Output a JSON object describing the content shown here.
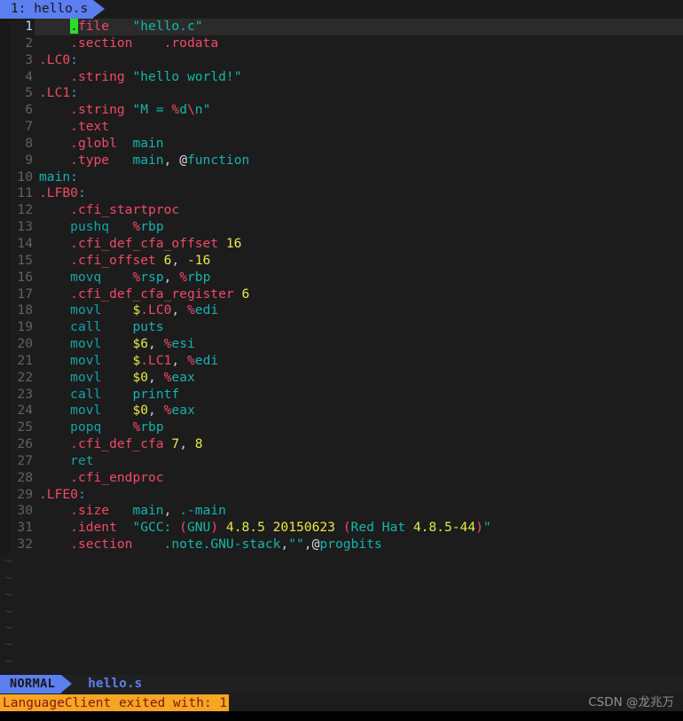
{
  "tabline": {
    "active_tab": "1: hello.s"
  },
  "editor": {
    "filetype": "asm",
    "cursor_char": ".",
    "lines": [
      {
        "n": "1",
        "current": true,
        "tokens": [
          {
            "t": "    ",
            "c": "punct"
          },
          {
            "t": ".",
            "c": "cursor"
          },
          {
            "t": "file",
            "c": "dir"
          },
          {
            "t": "   ",
            "c": "punct"
          },
          {
            "t": "\"hello.c\"",
            "c": "str"
          }
        ]
      },
      {
        "n": "2",
        "current": false,
        "tokens": [
          {
            "t": "    ",
            "c": "punct"
          },
          {
            "t": ".section",
            "c": "dir"
          },
          {
            "t": "    ",
            "c": "punct"
          },
          {
            "t": ".rodata",
            "c": "dir"
          }
        ]
      },
      {
        "n": "3",
        "current": false,
        "tokens": [
          {
            "t": ".LC0",
            "c": "lbl"
          },
          {
            "t": ":",
            "c": "colon"
          }
        ]
      },
      {
        "n": "4",
        "current": false,
        "tokens": [
          {
            "t": "    ",
            "c": "punct"
          },
          {
            "t": ".string",
            "c": "dir"
          },
          {
            "t": " ",
            "c": "punct"
          },
          {
            "t": "\"hello world!\"",
            "c": "str"
          }
        ]
      },
      {
        "n": "5",
        "current": false,
        "tokens": [
          {
            "t": ".LC1",
            "c": "lbl"
          },
          {
            "t": ":",
            "c": "colon"
          }
        ]
      },
      {
        "n": "6",
        "current": false,
        "tokens": [
          {
            "t": "    ",
            "c": "punct"
          },
          {
            "t": ".string",
            "c": "dir"
          },
          {
            "t": " ",
            "c": "punct"
          },
          {
            "t": "\"M = ",
            "c": "str"
          },
          {
            "t": "%",
            "c": "pct"
          },
          {
            "t": "d",
            "c": "str"
          },
          {
            "t": "\\",
            "c": "pct"
          },
          {
            "t": "n\"",
            "c": "str"
          }
        ]
      },
      {
        "n": "7",
        "current": false,
        "tokens": [
          {
            "t": "    ",
            "c": "punct"
          },
          {
            "t": ".text",
            "c": "dir"
          }
        ]
      },
      {
        "n": "8",
        "current": false,
        "tokens": [
          {
            "t": "    ",
            "c": "punct"
          },
          {
            "t": ".globl",
            "c": "dir"
          },
          {
            "t": "  ",
            "c": "punct"
          },
          {
            "t": "main",
            "c": "id"
          }
        ]
      },
      {
        "n": "9",
        "current": false,
        "tokens": [
          {
            "t": "    ",
            "c": "punct"
          },
          {
            "t": ".type",
            "c": "dir"
          },
          {
            "t": "   ",
            "c": "punct"
          },
          {
            "t": "main",
            "c": "id"
          },
          {
            "t": ", ",
            "c": "punct"
          },
          {
            "t": "@",
            "c": "at"
          },
          {
            "t": "function",
            "c": "id"
          }
        ]
      },
      {
        "n": "10",
        "current": false,
        "tokens": [
          {
            "t": "main",
            "c": "id"
          },
          {
            "t": ":",
            "c": "colon"
          }
        ]
      },
      {
        "n": "11",
        "current": false,
        "tokens": [
          {
            "t": ".LFB0",
            "c": "lbl"
          },
          {
            "t": ":",
            "c": "colon"
          }
        ]
      },
      {
        "n": "12",
        "current": false,
        "tokens": [
          {
            "t": "    ",
            "c": "punct"
          },
          {
            "t": ".cfi_startproc",
            "c": "dir"
          }
        ]
      },
      {
        "n": "13",
        "current": false,
        "tokens": [
          {
            "t": "    ",
            "c": "punct"
          },
          {
            "t": "pushq",
            "c": "kw"
          },
          {
            "t": "   ",
            "c": "punct"
          },
          {
            "t": "%",
            "c": "pct"
          },
          {
            "t": "rbp",
            "c": "id"
          }
        ]
      },
      {
        "n": "14",
        "current": false,
        "tokens": [
          {
            "t": "    ",
            "c": "punct"
          },
          {
            "t": ".cfi_def_cfa_offset",
            "c": "dir"
          },
          {
            "t": " ",
            "c": "punct"
          },
          {
            "t": "16",
            "c": "num"
          }
        ]
      },
      {
        "n": "15",
        "current": false,
        "tokens": [
          {
            "t": "    ",
            "c": "punct"
          },
          {
            "t": ".cfi_offset",
            "c": "dir"
          },
          {
            "t": " ",
            "c": "punct"
          },
          {
            "t": "6",
            "c": "num"
          },
          {
            "t": ", ",
            "c": "punct"
          },
          {
            "t": "-16",
            "c": "num"
          }
        ]
      },
      {
        "n": "16",
        "current": false,
        "tokens": [
          {
            "t": "    ",
            "c": "punct"
          },
          {
            "t": "movq",
            "c": "kw"
          },
          {
            "t": "    ",
            "c": "punct"
          },
          {
            "t": "%",
            "c": "pct"
          },
          {
            "t": "rsp",
            "c": "id"
          },
          {
            "t": ", ",
            "c": "punct"
          },
          {
            "t": "%",
            "c": "pct"
          },
          {
            "t": "rbp",
            "c": "id"
          }
        ]
      },
      {
        "n": "17",
        "current": false,
        "tokens": [
          {
            "t": "    ",
            "c": "punct"
          },
          {
            "t": ".cfi_def_cfa_register",
            "c": "dir"
          },
          {
            "t": " ",
            "c": "punct"
          },
          {
            "t": "6",
            "c": "num"
          }
        ]
      },
      {
        "n": "18",
        "current": false,
        "tokens": [
          {
            "t": "    ",
            "c": "punct"
          },
          {
            "t": "movl",
            "c": "kw"
          },
          {
            "t": "    ",
            "c": "punct"
          },
          {
            "t": "$",
            "c": "num"
          },
          {
            "t": ".LC0",
            "c": "lbl"
          },
          {
            "t": ", ",
            "c": "punct"
          },
          {
            "t": "%",
            "c": "pct"
          },
          {
            "t": "edi",
            "c": "id"
          }
        ]
      },
      {
        "n": "19",
        "current": false,
        "tokens": [
          {
            "t": "    ",
            "c": "punct"
          },
          {
            "t": "call",
            "c": "kw"
          },
          {
            "t": "    ",
            "c": "punct"
          },
          {
            "t": "puts",
            "c": "id"
          }
        ]
      },
      {
        "n": "20",
        "current": false,
        "tokens": [
          {
            "t": "    ",
            "c": "punct"
          },
          {
            "t": "movl",
            "c": "kw"
          },
          {
            "t": "    ",
            "c": "punct"
          },
          {
            "t": "$6",
            "c": "num"
          },
          {
            "t": ", ",
            "c": "punct"
          },
          {
            "t": "%",
            "c": "pct"
          },
          {
            "t": "esi",
            "c": "id"
          }
        ]
      },
      {
        "n": "21",
        "current": false,
        "tokens": [
          {
            "t": "    ",
            "c": "punct"
          },
          {
            "t": "movl",
            "c": "kw"
          },
          {
            "t": "    ",
            "c": "punct"
          },
          {
            "t": "$",
            "c": "num"
          },
          {
            "t": ".LC1",
            "c": "lbl"
          },
          {
            "t": ", ",
            "c": "punct"
          },
          {
            "t": "%",
            "c": "pct"
          },
          {
            "t": "edi",
            "c": "id"
          }
        ]
      },
      {
        "n": "22",
        "current": false,
        "tokens": [
          {
            "t": "    ",
            "c": "punct"
          },
          {
            "t": "movl",
            "c": "kw"
          },
          {
            "t": "    ",
            "c": "punct"
          },
          {
            "t": "$0",
            "c": "num"
          },
          {
            "t": ", ",
            "c": "punct"
          },
          {
            "t": "%",
            "c": "pct"
          },
          {
            "t": "eax",
            "c": "id"
          }
        ]
      },
      {
        "n": "23",
        "current": false,
        "tokens": [
          {
            "t": "    ",
            "c": "punct"
          },
          {
            "t": "call",
            "c": "kw"
          },
          {
            "t": "    ",
            "c": "punct"
          },
          {
            "t": "printf",
            "c": "id"
          }
        ]
      },
      {
        "n": "24",
        "current": false,
        "tokens": [
          {
            "t": "    ",
            "c": "punct"
          },
          {
            "t": "movl",
            "c": "kw"
          },
          {
            "t": "    ",
            "c": "punct"
          },
          {
            "t": "$0",
            "c": "num"
          },
          {
            "t": ", ",
            "c": "punct"
          },
          {
            "t": "%",
            "c": "pct"
          },
          {
            "t": "eax",
            "c": "id"
          }
        ]
      },
      {
        "n": "25",
        "current": false,
        "tokens": [
          {
            "t": "    ",
            "c": "punct"
          },
          {
            "t": "popq",
            "c": "kw"
          },
          {
            "t": "    ",
            "c": "punct"
          },
          {
            "t": "%",
            "c": "pct"
          },
          {
            "t": "rbp",
            "c": "id"
          }
        ]
      },
      {
        "n": "26",
        "current": false,
        "tokens": [
          {
            "t": "    ",
            "c": "punct"
          },
          {
            "t": ".cfi_def_cfa",
            "c": "dir"
          },
          {
            "t": " ",
            "c": "punct"
          },
          {
            "t": "7",
            "c": "num"
          },
          {
            "t": ", ",
            "c": "punct"
          },
          {
            "t": "8",
            "c": "num"
          }
        ]
      },
      {
        "n": "27",
        "current": false,
        "tokens": [
          {
            "t": "    ",
            "c": "punct"
          },
          {
            "t": "ret",
            "c": "kw"
          }
        ]
      },
      {
        "n": "28",
        "current": false,
        "tokens": [
          {
            "t": "    ",
            "c": "punct"
          },
          {
            "t": ".cfi_endproc",
            "c": "dir"
          }
        ]
      },
      {
        "n": "29",
        "current": false,
        "tokens": [
          {
            "t": ".LFE0",
            "c": "lbl"
          },
          {
            "t": ":",
            "c": "colon"
          }
        ]
      },
      {
        "n": "30",
        "current": false,
        "tokens": [
          {
            "t": "    ",
            "c": "punct"
          },
          {
            "t": ".size",
            "c": "dir"
          },
          {
            "t": "   ",
            "c": "punct"
          },
          {
            "t": "main",
            "c": "id"
          },
          {
            "t": ", ",
            "c": "punct"
          },
          {
            "t": ".-main",
            "c": "id"
          }
        ]
      },
      {
        "n": "31",
        "current": false,
        "tokens": [
          {
            "t": "    ",
            "c": "punct"
          },
          {
            "t": ".ident",
            "c": "dir"
          },
          {
            "t": "  ",
            "c": "punct"
          },
          {
            "t": "\"GCC: ",
            "c": "str"
          },
          {
            "t": "(",
            "c": "pct"
          },
          {
            "t": "GNU",
            "c": "str"
          },
          {
            "t": ")",
            "c": "pct"
          },
          {
            "t": " ",
            "c": "punct"
          },
          {
            "t": "4.8.5 20150623",
            "c": "num"
          },
          {
            "t": " ",
            "c": "punct"
          },
          {
            "t": "(",
            "c": "pct"
          },
          {
            "t": "Red Hat ",
            "c": "str"
          },
          {
            "t": "4.8.5-44",
            "c": "num"
          },
          {
            "t": ")",
            "c": "pct"
          },
          {
            "t": "\"",
            "c": "str"
          }
        ]
      },
      {
        "n": "32",
        "current": false,
        "tokens": [
          {
            "t": "    ",
            "c": "punct"
          },
          {
            "t": ".section",
            "c": "dir"
          },
          {
            "t": "    ",
            "c": "punct"
          },
          {
            "t": ".note.GNU-stack",
            "c": "str"
          },
          {
            "t": ",",
            "c": "punct"
          },
          {
            "t": "\"\"",
            "c": "str"
          },
          {
            "t": ",",
            "c": "punct"
          },
          {
            "t": "@",
            "c": "at"
          },
          {
            "t": "progbits",
            "c": "id"
          }
        ]
      }
    ],
    "filler_marker": "~",
    "filler_count": 7
  },
  "statusline": {
    "mode": "NORMAL",
    "filename": "hello.s"
  },
  "message": {
    "text": "LanguageClient exited with: 1"
  },
  "watermark": {
    "text": "CSDN @龙兆万"
  },
  "colors": {
    "accent_blue": "#5b7ff0",
    "editor_bg": "#1c1c1c",
    "cursorline_bg": "#2b2b2b",
    "cursor_green": "#2bdd2b",
    "directive_pink": "#f2496b",
    "string_teal": "#14b8a6",
    "number_yellow": "#e8e84a",
    "keyword_teal": "#16a3a3",
    "error_bg": "#f5a623",
    "error_fg": "#8a1414"
  }
}
